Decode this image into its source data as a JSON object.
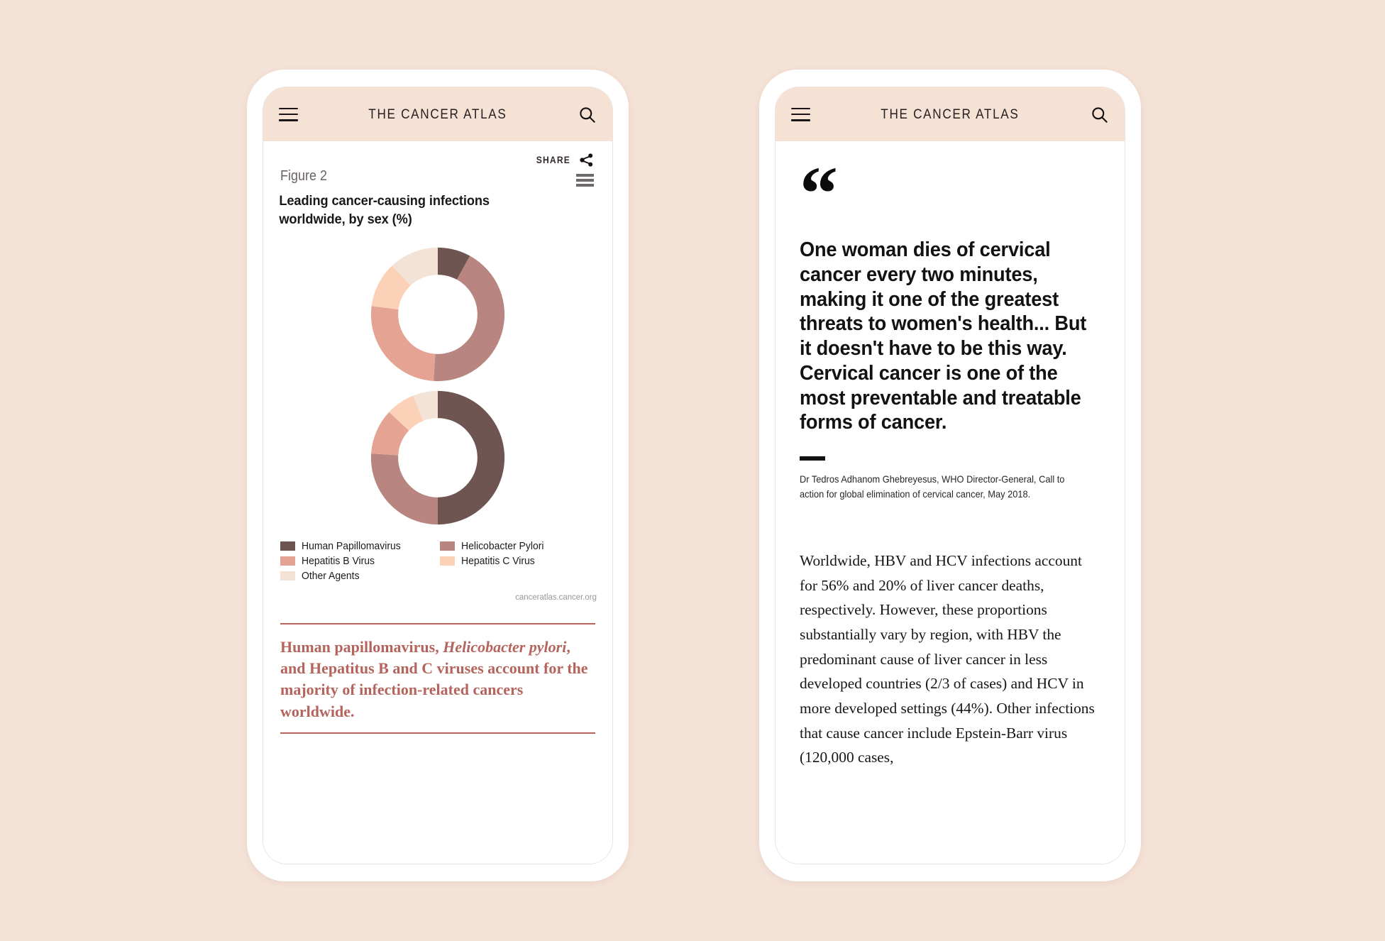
{
  "page": {
    "background_color": "#f5e2d6"
  },
  "appbar": {
    "title": "THE CANCER ATLAS",
    "menu_icon": "hamburger-icon",
    "search_icon": "search-icon"
  },
  "left_phone": {
    "share": {
      "label": "SHARE",
      "icon": "share-icon"
    },
    "figure": {
      "label": "Figure 2",
      "title": "Leading cancer-causing infections worldwide, by sex (%)",
      "menu_icon": "chart-menu-icon",
      "watermark": "canceratlas.cancer.org"
    },
    "legend": [
      {
        "label": "Human Papillomavirus",
        "color": "#6e5552"
      },
      {
        "label": "Helicobacter Pylori",
        "color": "#b88580"
      },
      {
        "label": "Hepatitis B Virus",
        "color": "#e5a493"
      },
      {
        "label": "Hepatitis C Virus",
        "color": "#fbd1b8"
      },
      {
        "label": "Other Agents",
        "color": "#f3e2d6"
      }
    ],
    "caption": {
      "part1": "Human papillomavirus, ",
      "italic": "Helicobacter pylori",
      "part2": ", and Hepatitus B and C viruses account for the majority of infection-related cancers worldwide.",
      "color": "#b4645c"
    }
  },
  "right_phone": {
    "quote_mark": "“",
    "quote": "One woman dies of cervical cancer every two minutes, making it one of the greatest threats to women's health... But it doesn't have to be this way. Cervical cancer is one of the most preventable and treatable forms of cancer.",
    "attribution": "Dr Tedros Adhanom Ghebreyesus, WHO Director-General, Call to action for global elimination of cervical cancer, May 2018.",
    "body": "Worldwide, HBV and HCV infections account for 56% and 20% of liver cancer deaths, respectively. However, these proportions substantially vary by region, with HBV the predominant cause of liver cancer in less developed countries (2/3 of cases) and HCV in more developed settings (44%). Other infections that cause cancer include Epstein-Barr virus (120,000 cases,"
  },
  "chart_data": [
    {
      "type": "pie",
      "variant": "donut",
      "title": "Leading cancer-causing infections worldwide, by sex (%)",
      "subtitle": "Figure 2",
      "panel": "top",
      "categories": [
        "Human Papillomavirus",
        "Helicobacter Pylori",
        "Hepatitis B Virus",
        "Hepatitis C Virus",
        "Other Agents"
      ],
      "values": [
        8,
        43,
        26,
        11,
        12
      ],
      "colors": [
        "#6e5552",
        "#b88580",
        "#e5a493",
        "#fbd1b8",
        "#f3e2d6"
      ],
      "start_angle_deg": 0,
      "direction": "clockwise",
      "legend_position": "bottom",
      "grid": false
    },
    {
      "type": "pie",
      "variant": "donut",
      "title": "Leading cancer-causing infections worldwide, by sex (%)",
      "panel": "bottom",
      "categories": [
        "Human Papillomavirus",
        "Helicobacter Pylori",
        "Hepatitis B Virus",
        "Hepatitis C Virus",
        "Other Agents"
      ],
      "values": [
        50,
        26,
        11,
        7,
        6
      ],
      "colors": [
        "#6e5552",
        "#b88580",
        "#e5a493",
        "#fbd1b8",
        "#f3e2d6"
      ],
      "start_angle_deg": 0,
      "direction": "clockwise",
      "legend_position": "bottom",
      "grid": false
    }
  ]
}
